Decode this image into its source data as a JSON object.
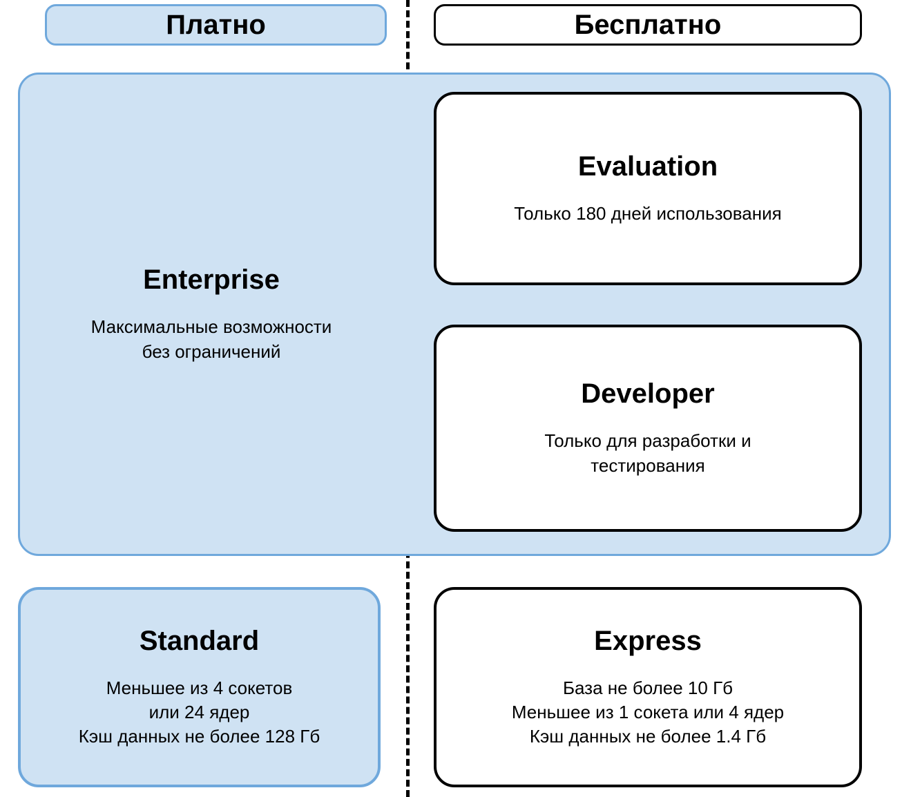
{
  "headers": {
    "paid": "Платно",
    "free": "Бесплатно"
  },
  "enterprise": {
    "title": "Enterprise",
    "desc_l1": "Максимальные возможности",
    "desc_l2": "без ограничений"
  },
  "evaluation": {
    "title": "Evaluation",
    "desc": "Только 180 дней использования"
  },
  "developer": {
    "title": "Developer",
    "desc_l1": "Только для разработки и",
    "desc_l2": "тестирования"
  },
  "standard": {
    "title": "Standard",
    "desc_l1": "Меньшее из 4 сокетов",
    "desc_l2": "или 24 ядер",
    "desc_l3": "Кэш данных не более 128 Гб"
  },
  "express": {
    "title": "Express",
    "desc_l1": "База не более 10 Гб",
    "desc_l2": "Меньшее из 1 сокета или 4 ядер",
    "desc_l3": "Кэш данных не более 1.4 Гб"
  }
}
